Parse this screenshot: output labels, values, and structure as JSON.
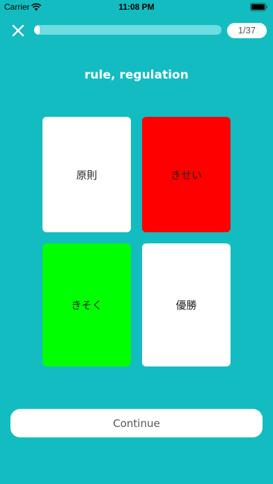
{
  "status_bar": {
    "carrier": "Carrier",
    "time": "11:08 PM",
    "wifi_icon": "wifi-icon",
    "battery_icon": "battery-icon"
  },
  "header": {
    "close_icon": "close-icon",
    "progress_fraction": 0.027,
    "counter": "1/37"
  },
  "prompt": "rule, regulation",
  "cards": [
    {
      "label": "原則",
      "color": "#ffffff",
      "state": "neutral"
    },
    {
      "label": "きせい",
      "color": "#ff0000",
      "state": "wrong"
    },
    {
      "label": "きそく",
      "color": "#00ff00",
      "state": "correct"
    },
    {
      "label": "優勝",
      "color": "#ffffff",
      "state": "neutral"
    }
  ],
  "continue_label": "Continue",
  "colors": {
    "background": "#13bcc1",
    "progress_track": "#6ddde0",
    "correct": "#00ff00",
    "wrong": "#ff0000"
  }
}
